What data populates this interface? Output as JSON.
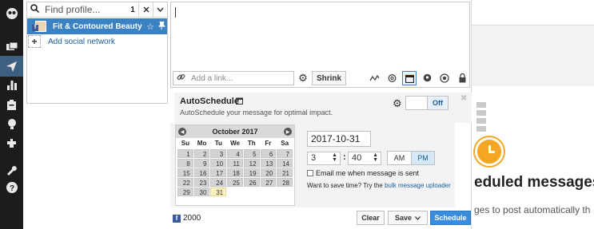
{
  "nav": {
    "items": [
      {
        "icon": "owl-logo-icon",
        "glyph": "🦉"
      },
      {
        "icon": "streams-icon",
        "glyph": "▤"
      },
      {
        "icon": "compose-icon",
        "glyph": "➤",
        "active": true
      },
      {
        "icon": "analytics-icon",
        "glyph": "▮"
      },
      {
        "icon": "assignments-icon",
        "glyph": "▣"
      },
      {
        "icon": "campaigns-icon",
        "glyph": "●"
      },
      {
        "icon": "apps-icon",
        "glyph": "✚"
      },
      {
        "icon": "tools-icon",
        "glyph": "🔧"
      },
      {
        "icon": "help-icon",
        "glyph": "?"
      }
    ]
  },
  "profiles": {
    "search_placeholder": "Find profile...",
    "selected_count": "1",
    "selected_name": "Fit & Contoured Beauty a...",
    "add_label": "Add social network"
  },
  "message": {
    "link_placeholder": "Add a link...",
    "shrink_label": "Shrink"
  },
  "autoschedule": {
    "title": "AutoSchedule",
    "description": "AutoSchedule your message for optimal impact.",
    "toggle_label": "Off"
  },
  "calendar": {
    "month": "October 2017",
    "weekdays": [
      "Su",
      "Mo",
      "Tu",
      "We",
      "Th",
      "Fr",
      "Sa"
    ],
    "weeks": [
      [
        "1",
        "2",
        "3",
        "4",
        "5",
        "6",
        "7"
      ],
      [
        "8",
        "9",
        "10",
        "11",
        "12",
        "13",
        "14"
      ],
      [
        "15",
        "16",
        "17",
        "18",
        "19",
        "20",
        "21"
      ],
      [
        "22",
        "23",
        "24",
        "25",
        "26",
        "27",
        "28"
      ],
      [
        "29",
        "30",
        "31",
        "",
        "",
        "",
        ""
      ]
    ],
    "today": "31"
  },
  "schedule": {
    "date": "2017-10-31",
    "hour": "3",
    "minute": "40",
    "am_label": "AM",
    "pm_label": "PM",
    "email_label": "Email me when message is sent",
    "save_time_text": "Want to save time? Try the ",
    "bulk_link": "bulk message uploader"
  },
  "footer": {
    "fb_count": "2000",
    "clear_label": "Clear",
    "save_label": "Save",
    "schedule_label": "Schedule"
  },
  "background": {
    "title": "eduled messages",
    "subtitle": "ges to post automatically th"
  },
  "colors": {
    "accent": "#3a82c4",
    "facebook": "#3b5998",
    "nav_bg": "#1c1c1c",
    "clock": "#f5a623"
  }
}
